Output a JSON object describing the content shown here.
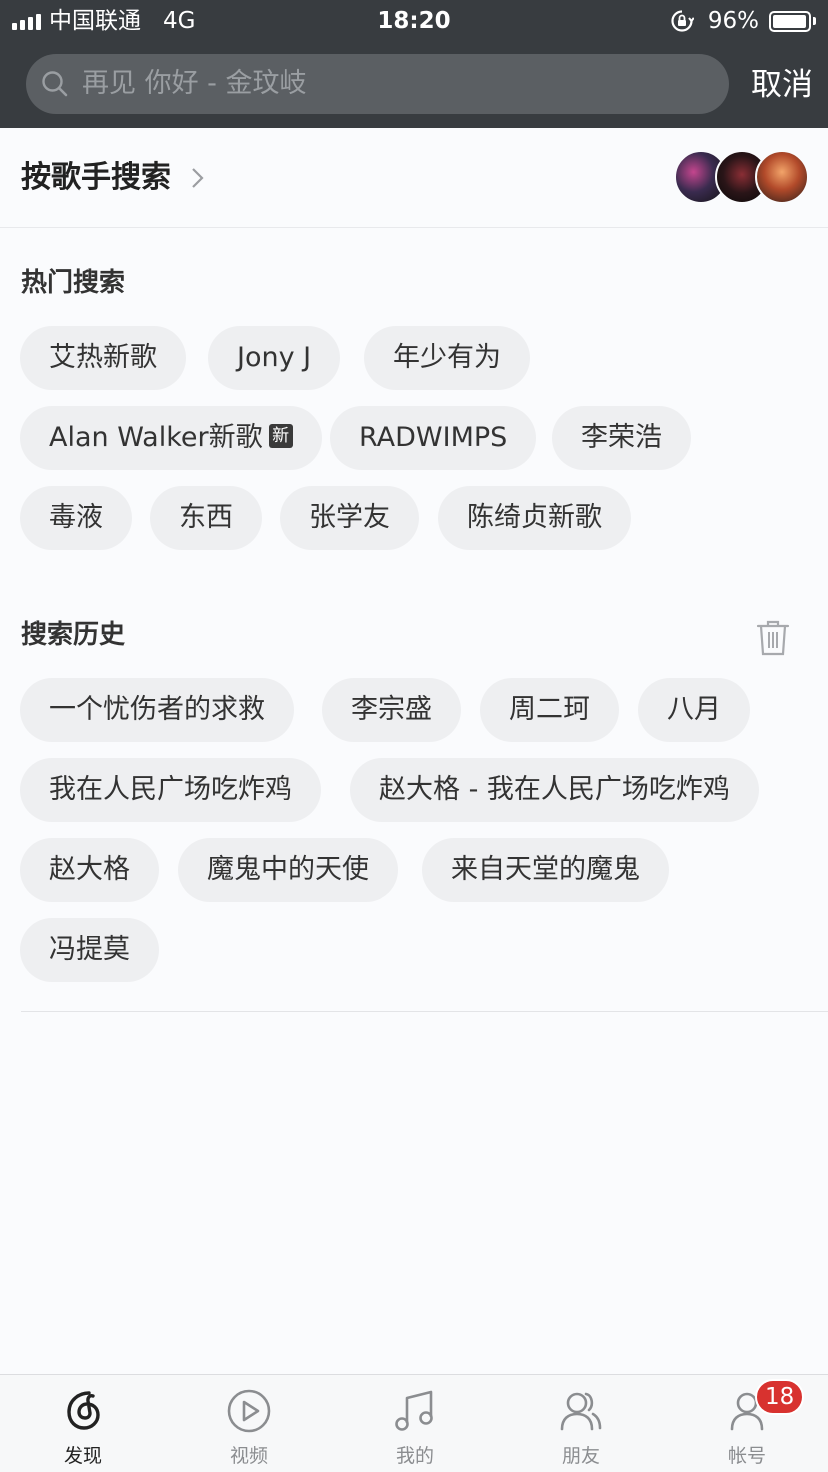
{
  "status_bar": {
    "carrier": "中国联通",
    "network": "4G",
    "time": "18:20",
    "battery": "96%",
    "battery_level": 0.96
  },
  "search": {
    "placeholder": "再见 你好 - 金玟岐",
    "cancel_label": "取消"
  },
  "singer_search": {
    "label": "按歌手搜索",
    "avatars": [
      "avatar-1",
      "avatar-2",
      "avatar-3"
    ]
  },
  "hot_search": {
    "title": "热门搜索",
    "tags": [
      {
        "label": "艾热新歌"
      },
      {
        "label": "Jony J"
      },
      {
        "label": "年少有为"
      },
      {
        "label": "Alan Walker新歌",
        "badge": "新"
      },
      {
        "label": "RADWIMPS"
      },
      {
        "label": "李荣浩"
      },
      {
        "label": "毒液"
      },
      {
        "label": "东西"
      },
      {
        "label": "张学友"
      },
      {
        "label": "陈绮贞新歌"
      }
    ]
  },
  "history": {
    "title": "搜索历史",
    "items": [
      "一个忧伤者的求救",
      "李宗盛",
      "周二珂",
      "八月",
      "我在人民广场吃炸鸡",
      "赵大格 - 我在人民广场吃炸鸡",
      "赵大格",
      "魔鬼中的天使",
      "来自天堂的魔鬼",
      "冯提莫"
    ]
  },
  "tabbar": {
    "tabs": [
      {
        "label": "发现",
        "icon": "netease-music-icon",
        "active": true
      },
      {
        "label": "视频",
        "icon": "video-play-icon"
      },
      {
        "label": "我的",
        "icon": "music-note-icon"
      },
      {
        "label": "朋友",
        "icon": "friends-icon"
      },
      {
        "label": "帐号",
        "icon": "account-icon",
        "badge": "18"
      }
    ]
  },
  "colors": {
    "header_bg": "#383c40",
    "search_bg": "#5b5f63",
    "chip_bg": "#eeeff1",
    "badge_red": "#d8322f"
  }
}
